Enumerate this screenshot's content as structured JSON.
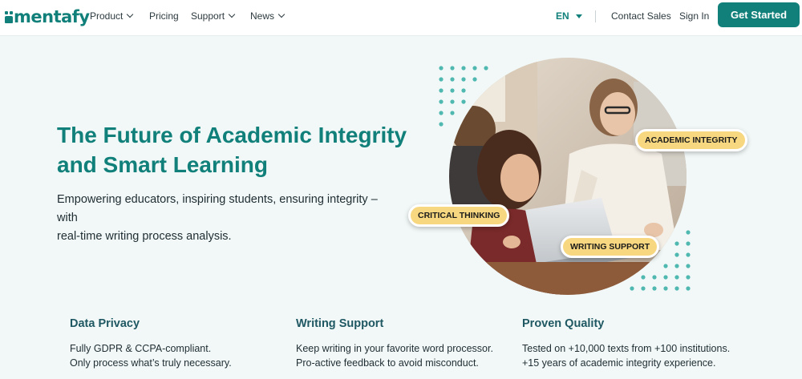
{
  "brand": {
    "name": "mentafy",
    "color": "#12807a"
  },
  "nav": {
    "items": [
      {
        "label": "Product",
        "has_dropdown": true
      },
      {
        "label": "Pricing",
        "has_dropdown": false
      },
      {
        "label": "Support",
        "has_dropdown": true
      },
      {
        "label": "News",
        "has_dropdown": true
      }
    ],
    "language": "EN",
    "contact_sales": "Contact Sales",
    "sign_in": "Sign In",
    "cta": "Get Started"
  },
  "hero": {
    "title_line1": "The Future of Academic Integrity",
    "title_line2": "and Smart Learning",
    "subtitle_line1": "Empowering educators, inspiring students, ensuring integrity – with",
    "subtitle_line2": "real-time writing process analysis.",
    "badges": {
      "academic_integrity": "ACADEMIC INTEGRITY",
      "critical_thinking": "CRITICAL THINKING",
      "writing_support": "WRITING SUPPORT"
    },
    "badge_color": "#f7d880",
    "dot_color": "#4fb8b0"
  },
  "features": [
    {
      "title": "Data Privacy",
      "line1": "Fully GDPR & CCPA-compliant.",
      "line2": "Only process what’s truly necessary."
    },
    {
      "title": "Writing Support",
      "line1": "Keep writing in your favorite word processor.",
      "line2": "Pro-active feedback to avoid misconduct."
    },
    {
      "title": "Proven Quality",
      "line1": "Tested on +10,000 texts from +100 institutions.",
      "line2": "+15 years of academic integrity experience."
    }
  ]
}
